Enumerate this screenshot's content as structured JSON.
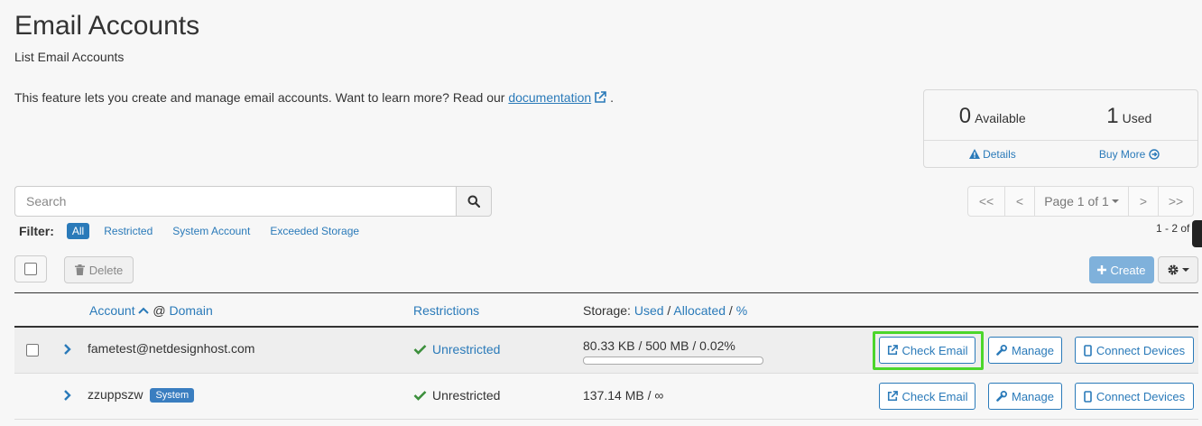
{
  "header": {
    "title": "Email Accounts",
    "subtitle": "List Email Accounts",
    "intro": "This feature lets you create and manage email accounts. Want to learn more? Read our",
    "doc_link": "documentation",
    "intro_end": "."
  },
  "stats": {
    "available_count": "0",
    "available_label": "Available",
    "used_count": "1",
    "used_label": "Used",
    "details_link": "Details",
    "buy_more_link": "Buy More"
  },
  "search": {
    "placeholder": "Search"
  },
  "pagination": {
    "first": "<<",
    "prev": "<",
    "page_label": "Page 1 of 1",
    "next": ">",
    "last": ">>",
    "count_text": "1 - 2 of"
  },
  "filter": {
    "label": "Filter:",
    "options": [
      "All",
      "Restricted",
      "System Account",
      "Exceeded Storage"
    ],
    "active": "All"
  },
  "actions": {
    "delete_label": "Delete",
    "create_label": "Create"
  },
  "table": {
    "headers": {
      "account": "Account",
      "at": "@",
      "domain": "Domain",
      "restrictions": "Restrictions",
      "storage": "Storage:",
      "used": "Used",
      "allocated": "Allocated",
      "percent": "%",
      "sep1": "/",
      "sep2": "/"
    },
    "rows": [
      {
        "account": "fametest@netdesignhost.com",
        "badge": "",
        "restriction": "Unrestricted",
        "storage": "80.33 KB / 500 MB / 0.02%",
        "usage_fraction": 0.0002,
        "check_email": "Check Email",
        "manage": "Manage",
        "connect": "Connect Devices"
      },
      {
        "account": "zzuppszw",
        "badge": "System",
        "restriction": "Unrestricted",
        "storage": "137.14 MB / ∞",
        "check_email": "Check Email",
        "manage": "Manage",
        "connect": "Connect Devices"
      }
    ]
  },
  "colors": {
    "link": "#2a7ab9",
    "success": "#3c8f3c",
    "highlight": "#4cd62b",
    "create_button": "#7fb1db"
  }
}
